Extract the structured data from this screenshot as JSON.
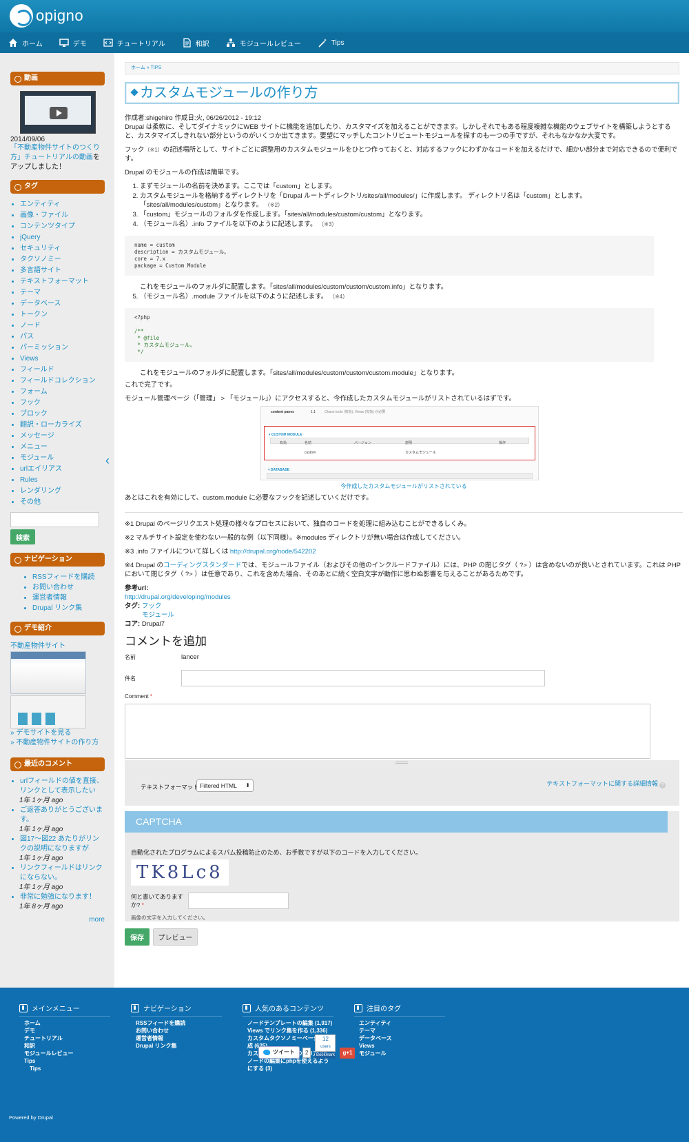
{
  "header": {
    "logo_text": "opigno"
  },
  "nav": {
    "items": [
      {
        "label": "ホーム",
        "icon": "home-icon"
      },
      {
        "label": "デモ",
        "icon": "monitor-icon"
      },
      {
        "label": "チュートリアル",
        "icon": "code-icon"
      },
      {
        "label": "和訳",
        "icon": "document-icon"
      },
      {
        "label": "モジュールレビュー",
        "icon": "network-icon"
      },
      {
        "label": "Tips",
        "icon": "magic-wand-icon"
      }
    ]
  },
  "sidebar": {
    "video": {
      "title": "動画",
      "date": "2014/09/06",
      "link_text": "「不動産物件サイトのつくり方」チュートリアルの動画",
      "after_text": "をアップしました！"
    },
    "tags": {
      "title": "タグ",
      "items": [
        "エンティティ",
        "画像・ファイル",
        "コンテンツタイプ",
        "jQuery",
        "セキュリティ",
        "タクソノミー",
        "多言語サイト",
        "テキストフォーマット",
        "テーマ",
        "データベース",
        "トークン",
        "ノード",
        "パス",
        "パーミッション",
        "Views",
        "フィールド",
        "フィールドコレクション",
        "フォーム",
        "フック",
        "ブロック",
        "翻訳・ローカライズ",
        "メッセージ",
        "メニュー",
        "モジュール",
        "urlエイリアス",
        "Rules",
        "レンダリング",
        "その他"
      ]
    },
    "search": {
      "button": "検索"
    },
    "navigation": {
      "title": "ナビゲーション",
      "items": [
        "RSSフィードを購読",
        "お問い合わせ",
        "運営者情報",
        "Drupal リンク集"
      ]
    },
    "demo": {
      "title": "デモ紹介",
      "link": "不動産物件サイト",
      "see_demo": "» デモサイトを見る",
      "howto": "» 不動産物件サイトの作り方"
    },
    "recent_comments": {
      "title": "最近のコメント",
      "items": [
        {
          "text": "urlフィールドの値を直接、リンクとして表示したい",
          "ago": "1年 1ヶ月 ago"
        },
        {
          "text": "ご返答ありがとうございます。",
          "ago": "1年 1ヶ月 ago"
        },
        {
          "text": "図17〜図22 あたりがリンクの説明になりますが",
          "ago": "1年 1ヶ月 ago"
        },
        {
          "text": "リンクフィールドはリンクにならない。",
          "ago": "1年 1ヶ月 ago"
        },
        {
          "text": "非常に勉強になります！",
          "ago": "1年 8ヶ月 ago"
        }
      ],
      "more": "more"
    }
  },
  "main": {
    "breadcrumb": "ホーム » TIPS",
    "title": "カスタムモジュールの作り方",
    "meta": "作成者:shigehiro 作成日:火, 06/26/2012 - 19:12",
    "intro1": "Drupal は柔軟に、そしてダイナミックにWEB サイトに機能を追加したり、カスタマイズを加えることができます。しかしそれでもある程度複雑な機能のウェブサイトを構築しようとすると、カスタマイズしきれない部分というのがいくつか出てきます。要望にマッチしたコントリビュートモジュールを探すのも一つの手ですが、それもなかなか大変です。",
    "intro2_a": "フック",
    "intro2_note": "（※1）",
    "intro2_b": "の記述場所として、サイトごとに調整用のカスタムモジュールをひとつ作っておくと、対応するフックにわずかなコードを加えるだけで、細かい部分まで対応できるので便利です。",
    "intro3": "Drupal のモジュールの作成は簡単です。",
    "step1": "まずモジュールの名前を決めます。ここでは「custom」とします。",
    "step2a": "カスタムモジュールを格納するディレクトリを「Drupal ルートディレクトリ/sites/all/modules/」に作成します。 ディレクトリ名は「custom」とします。",
    "step2b": "「sites/all/modules/custom」となります。",
    "step2_note": "（※2）",
    "step3": "「custom」モジュールのフォルダを作成します。「sites/all/modules/custom/custom」となります。",
    "step4": "（モジュール名）.info ファイルを以下のように記述します。",
    "step4_note": "（※3）",
    "code_info": "name = custom\ndescription = カスタムモジュール。\ncore = 7.x\npackage = Custom Module",
    "step4_after": "これをモジュールのフォルダに配置します。「sites/all/modules/custom/custom/custom.info」となります。",
    "step5": "（モジュール名）.module ファイルを以下のように記述します。",
    "step5_note": "（※4）",
    "code_module_1": "<?php",
    "code_module_2": "/**\n * @file\n * カスタムモジュール。\n */",
    "step5_after": "これをモジュールのフォルダに配置します。「sites/all/modules/custom/custom/custom.module」となります。",
    "done": "これで完了です。",
    "admin": "モジュール管理ページ（「管理」 > 「モジュール」）にアクセスすると、今作成したカスタムモジュールがリストされているはずです。",
    "shot": {
      "content_panes": "content panes",
      "version": "1.1",
      "requires": "Chaos tools (有効), Views (有効) が必要",
      "section_custom": "▾ CUSTOM MODULE",
      "col_enable": "有効",
      "col_name": "名前",
      "col_version": "バージョン",
      "col_desc": "説明",
      "col_ops": "操作",
      "row_name": "custom",
      "row_desc": "カスタムモジュール",
      "section_db": "▾ DATABASE"
    },
    "caption": "今作成したカスタムモジュールがリストされている",
    "after": "あとはこれを有効にして、custom.module に必要なフックを記述していくだけです。",
    "fn1": "※1 Drupal のページリクエスト処理の様々なプロセスにおいて、独自のコードを処理に組み込むことができるしくみ。",
    "fn2": "※2 マルチサイト設定を使わない一般的な例（以下同様）。※modules ディレクトリが無い場合は作成してください。",
    "fn3_text": "※3 .info ファイルについて詳しくは",
    "fn3_link": "http://drupal.org/node/542202",
    "fn4_a": "※4 Drupal の",
    "fn4_link": "コーディングスタンダード",
    "fn4_b": "では、モジュールファイル（およびその他のインクルードファイル）には、PHP の閉じタグ（ ?> ）は含めないのが良いとされています。これは PHP において閉じタグ（ ?> ）は任意であり、これを含めた場合、そのあとに続く空白文字が動作に思わぬ影響を与えることがあるためです。",
    "ref_label": "参考url:",
    "ref_link": "http://drupal.org/developing/modules",
    "tags_label": "タグ:",
    "tag1": "フック",
    "tag2": "モジュール",
    "core_label": "コア:",
    "core_val": "Drupal7"
  },
  "comment_form": {
    "title": "コメントを追加",
    "name_label": "名前",
    "name_value": "lancer",
    "subject_label": "件名",
    "comment_label": "Comment",
    "required_mark": "*",
    "format_label": "テキストフォーマット",
    "format_value": "Filtered HTML",
    "format_help": "テキストフォーマットに関する詳細情報",
    "captcha_title": "CAPTCHA",
    "captcha_desc": "自動化されたプログラムによるスパム投稿防止のため、お手数ですが以下のコードを入力してください。",
    "captcha_code": "TK8Lc8",
    "captcha_question": "何と書いてありますか?",
    "captcha_hint": "画像の文字を入力してください。",
    "save": "保存",
    "preview": "プレビュー"
  },
  "footer": {
    "cols": [
      {
        "title": "メインメニュー",
        "items": [
          "ホーム",
          "デモ",
          "チュートリアル",
          "和訳",
          "モジュールレビュー",
          "Tips"
        ],
        "sub": "Tips"
      },
      {
        "title": "ナビゲーション",
        "items": [
          "RSSフィードを購読",
          "お問い合わせ",
          "運営者情報",
          "Drupal リンク集"
        ]
      },
      {
        "title": "人気のあるコンテンツ",
        "items": [
          "ノードテンプレートの編集 (1,917)",
          "Views でリンク集を作る (1,336)",
          "カスタムタクソノミーページの作成 (625)",
          "カスタムモジュールの作り方 (9)",
          "ノードの編集にphpを使えるようにする (3)"
        ]
      },
      {
        "title": "注目のタグ",
        "items": [
          "エンティティ",
          "テーマ",
          "データベース",
          "Views",
          "モジュール"
        ]
      }
    ],
    "tweet": "ツイート",
    "tweet_count": "2",
    "bookmark_count": "12",
    "bookmark_users": "users",
    "bookmark_label": "Bookmark",
    "gplus": "g+1",
    "powered": "Powered by Drupal"
  }
}
